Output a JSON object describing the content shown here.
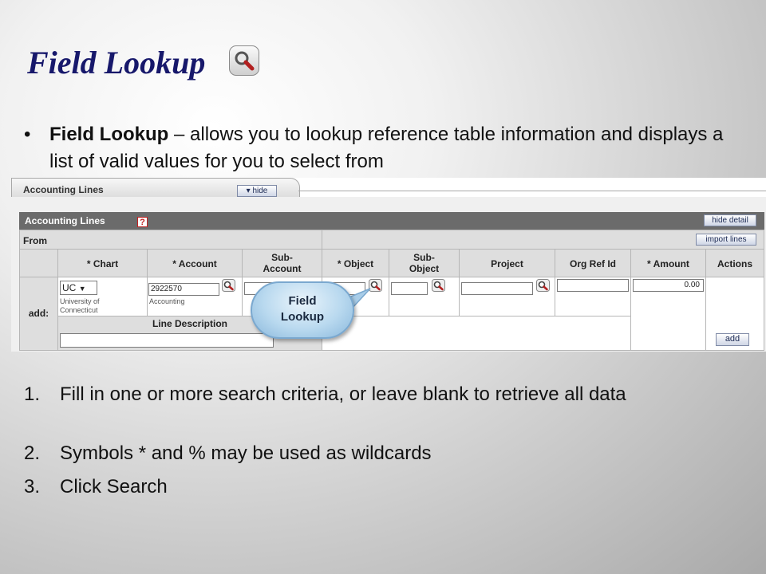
{
  "slide": {
    "title": "Field Lookup",
    "title_icon": "magnifier-icon",
    "bullet_bold": "Field Lookup",
    "bullet_rest": " – allows you to lookup reference table information and displays a list of valid values for you to select from",
    "steps": [
      {
        "num": "1.",
        "text": "Fill in one or more search criteria, or leave blank to retrieve all data"
      },
      {
        "num": "2.",
        "text": "Symbols * and % may be used as wildcards"
      },
      {
        "num": "3.",
        "text": "Click Search"
      }
    ]
  },
  "screen": {
    "tab_title": "Accounting Lines",
    "tab_hide_label": "hide",
    "section_title": "Accounting Lines",
    "help_icon": "?",
    "hide_detail_label": "hide detail",
    "import_lines_label": "import lines",
    "from_label": "From",
    "columns": {
      "chart": "* Chart",
      "account": "* Account",
      "sub_account_1": "Sub-",
      "sub_account_2": "Account",
      "object": "* Object",
      "sub_object_1": "Sub-",
      "sub_object_2": "Object",
      "project": "Project",
      "org_ref_id": "Org Ref Id",
      "amount": "* Amount",
      "actions": "Actions"
    },
    "row_label": "add:",
    "chart_value": "UC",
    "chart_desc_1": "University of",
    "chart_desc_2": "Connecticut",
    "account_value": "2922570",
    "account_desc": "Accounting",
    "amount_value": "0.00",
    "line_description_label": "Line Description",
    "add_label": "add",
    "callout_line1": "Field",
    "callout_line2": "Lookup"
  }
}
